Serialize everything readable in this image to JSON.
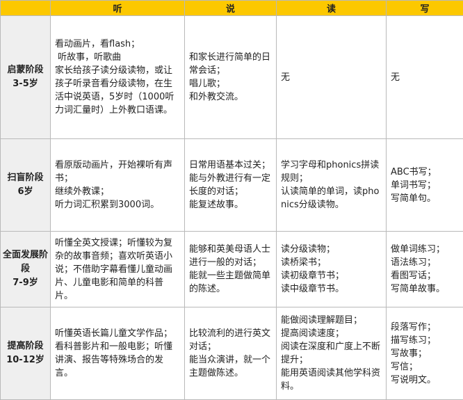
{
  "colors": {
    "header_bg": "#fcc800",
    "stage_bg": "#efefef",
    "border": "#b9b9b9"
  },
  "header": {
    "corner": "",
    "listen": "听",
    "speak": "说",
    "read": "读",
    "write": "写"
  },
  "rows": [
    {
      "stage_name": "启蒙阶段",
      "stage_age": "3-5岁",
      "listen": "看动画片，看flash；\n 听故事，听歌曲\n家长给孩子读分级读物，或让孩子听录音看分级读物，在生活中说英语，5岁时（1000听力词汇量时）上外教口语课。",
      "speak": "和家长进行简单的日常会话；\n唱儿歌；\n和外教交流。",
      "read": "无",
      "write": "无"
    },
    {
      "stage_name": "扫盲阶段",
      "stage_age": "6岁",
      "listen": "看原版动画片，开始裸听有声书；\n继续外教课；\n听力词汇积累到3000词。",
      "speak": "日常用语基本过关；\n能与外教进行有一定长度的对话；\n能复述故事。",
      "read": "学习字母和phonics拼读规则；\n认读简单的单词，读phonics分级读物。",
      "write": "ABC书写；\n单词书写；\n写简单句。"
    },
    {
      "stage_name": "全面发展阶段",
      "stage_age": "7-9岁",
      "listen": "听懂全英文授课；听懂较为复杂的故事音频；喜欢听英语小说；不借助字幕看懂儿童动画片、儿童电影和简单的科普片。",
      "speak": "能够和英美母语人士进行一般的对话；\n能就一些主题做简单的陈述。",
      "read": "读分级读物；\n读桥梁书；\n读初级章节书；\n读中级章节书。",
      "write": "做单词练习；\n语法练习；\n看图写话；\n写简单故事。"
    },
    {
      "stage_name": "提高阶段",
      "stage_age": "10-12岁",
      "listen": "听懂英语长篇儿童文学作品；看科普影片和一般电影；听懂讲演、报告等特殊场合的发言。",
      "speak": "比较流利的进行英文对话；\n能当众演讲，就一个主题做陈述。",
      "read": "能做阅读理解题目；\n提高阅读速度；\n阅读在深度和广度上不断提升；\n能用英语阅读其他学科资料。",
      "write": "段落写作；\n描写练习；\n写故事；\n写信；\n写说明文。"
    }
  ]
}
